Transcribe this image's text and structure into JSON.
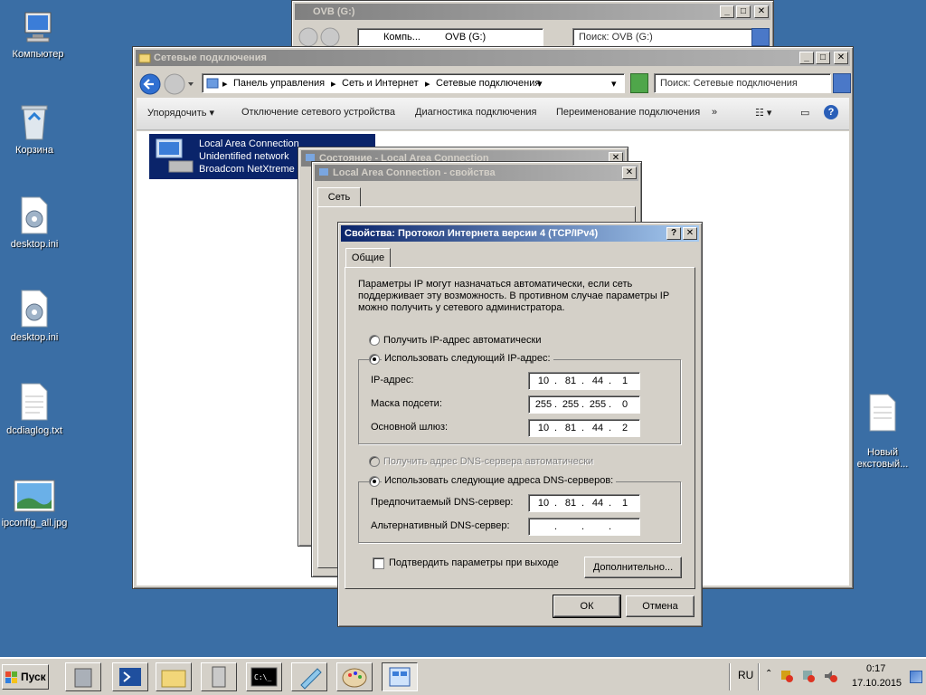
{
  "desktop": {
    "icons": [
      {
        "label": "Компьютер",
        "icon": "computer-icon"
      },
      {
        "label": "Корзина",
        "icon": "recycle-bin-icon"
      },
      {
        "label": "desktop.ini",
        "icon": "settings-file-icon"
      },
      {
        "label": "desktop.ini",
        "icon": "settings-file-icon"
      },
      {
        "label": "dcdiaglog.txt",
        "icon": "text-file-icon"
      },
      {
        "label": "ipconfig_all.jpg",
        "icon": "image-file-icon"
      },
      {
        "label": "Новый\nекстовый...",
        "icon": "text-file-icon"
      }
    ]
  },
  "ovb_window": {
    "title": "OVB (G:)",
    "breadcrumb": [
      "Компь...",
      "OVB (G:)"
    ],
    "search_placeholder": "Поиск: OVB (G:)"
  },
  "net_window": {
    "title": "Сетевые подключения",
    "breadcrumb": [
      "Панель управления",
      "Сеть и Интернет",
      "Сетевые подключения"
    ],
    "search_placeholder": "Поиск: Сетевые подключения",
    "commands": [
      "Упорядочить",
      "Отключение сетевого устройства",
      "Диагностика подключения",
      "Переименование подключения",
      "»"
    ],
    "connection": {
      "name": "Local Area Connection",
      "status": "Unidentified network",
      "adapter": "Broadcom NetXtreme G"
    }
  },
  "status_window": {
    "title": "Состояние - Local Area Connection"
  },
  "props_window": {
    "title": "Local Area Connection - свойства",
    "tab": "Сеть"
  },
  "ipv4_dialog": {
    "title": "Свойства: Протокол Интернета версии 4 (TCP/IPv4)",
    "help_btn": "?",
    "close_btn": "✕",
    "tab": "Общие",
    "description": "Параметры IP могут назначаться автоматически, если сеть поддерживает эту возможность. В противном случае параметры IP можно получить у сетевого администратора.",
    "auto_ip_label": "Получить IP-адрес автоматически",
    "manual_ip_label": "Использовать следующий IP-адрес:",
    "ip_label": "IP-адрес:",
    "ip_value": [
      "10",
      "81",
      "44",
      "1"
    ],
    "mask_label": "Маска подсети:",
    "mask_value": [
      "255",
      "255",
      "255",
      "0"
    ],
    "gateway_label": "Основной шлюз:",
    "gateway_value": [
      "10",
      "81",
      "44",
      "2"
    ],
    "auto_dns_label": "Получить адрес DNS-сервера автоматически",
    "manual_dns_label": "Использовать следующие адреса DNS-серверов:",
    "pref_dns_label": "Предпочитаемый DNS-сервер:",
    "pref_dns_value": [
      "10",
      "81",
      "44",
      "1"
    ],
    "alt_dns_label": "Альтернативный DNS-сервер:",
    "alt_dns_value": [
      "",
      "",
      "",
      ""
    ],
    "validate_label": "Подтвердить параметры при выходе",
    "advanced_btn": "Дополнительно...",
    "ok_btn": "ОК",
    "cancel_btn": "Отмена"
  },
  "taskbar": {
    "start_label": "Пуск",
    "language": "RU",
    "time": "0:17",
    "date": "17.10.2015"
  },
  "colors": {
    "desktop": "#3a6ea5",
    "selection": "#0a246a",
    "title_active": "#0a246a"
  }
}
